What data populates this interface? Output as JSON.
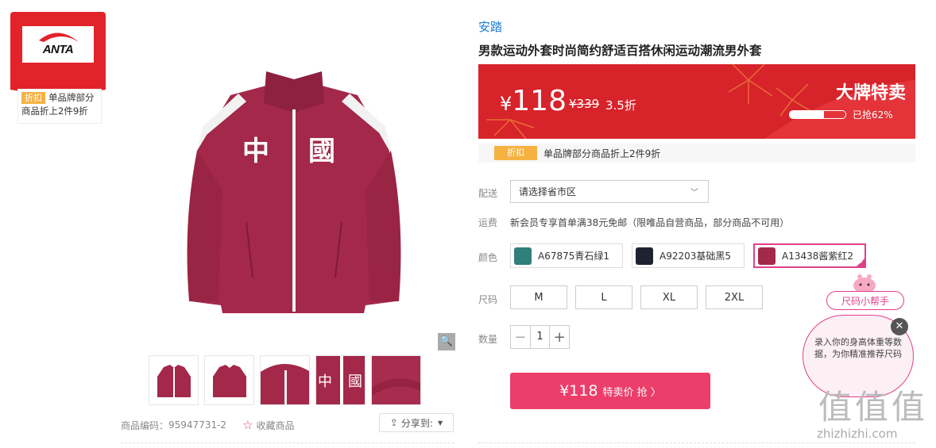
{
  "brand_card": {
    "logo_text": "ANTA",
    "promo_tag": "折扣",
    "promo_text": "单品牌部分商品折上2件9折"
  },
  "gallery": {
    "thumbnail_count": 5,
    "item_code_label": "商品编码：",
    "item_code": "95947731-2",
    "favorite_label": "收藏商品",
    "share_label": "分享到:"
  },
  "product": {
    "brand": "安踏",
    "title": "男款运动外套时尚简约舒适百搭休闲运动潮流男外套",
    "price_symbol": "¥",
    "price": "118",
    "original_price": "¥339",
    "discount": "3.5折",
    "banner_title": "大牌特卖",
    "sold_text": "已抢62%",
    "sold_fraction": 0.62,
    "promo_tag": "折扣",
    "promo_text": "单品牌部分商品折上2件9折"
  },
  "delivery": {
    "label": "配送",
    "placeholder": "请选择省市区"
  },
  "shipping": {
    "label": "运费",
    "text": "新会员专享首单满38元免邮（限唯品自营商品，部分商品不可用）"
  },
  "colors": {
    "label": "颜色",
    "options": [
      {
        "name": "A67875青石绿1",
        "swatch": "#2f7f7a"
      },
      {
        "name": "A92203基础黑5",
        "swatch": "#1e2230"
      },
      {
        "name": "A13438酱紫红2",
        "swatch": "#a3284a",
        "selected": true
      }
    ]
  },
  "sizes": {
    "label": "尺码",
    "options": [
      "M",
      "L",
      "XL",
      "2XL"
    ]
  },
  "quantity": {
    "label": "数量",
    "minus": "−",
    "value": "1",
    "plus": "+"
  },
  "buy_button": {
    "price": "¥118",
    "label": "特卖价 抢 〉"
  },
  "size_helper": {
    "button": "尺码小帮手",
    "text": "录入你的身高体重等数据，为你精准推荐尺码"
  },
  "watermark": {
    "logo": "值值值",
    "site": "zhizhizhi.com"
  },
  "colors_theme": {
    "accent": "#e2232a",
    "buy": "#ec3e6b",
    "link": "#1a7bd0",
    "tag": "#f6b241"
  }
}
